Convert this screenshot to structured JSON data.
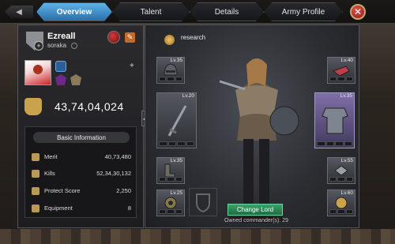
{
  "tabs": [
    {
      "label": "Overview",
      "active": true
    },
    {
      "label": "Talent",
      "active": false
    },
    {
      "label": "Details",
      "active": false
    },
    {
      "label": "Army Profile",
      "active": false
    }
  ],
  "player": {
    "name": "Ezreall",
    "guild": "soraka",
    "power": "43,74,04,024"
  },
  "basic_info": {
    "title": "Basic Information",
    "rows": [
      {
        "label": "Merit",
        "value": "40,73,480",
        "icon": "merit-icon"
      },
      {
        "label": "Kills",
        "value": "52,34,30,132",
        "icon": "swords-icon"
      },
      {
        "label": "Protect Score",
        "value": "2,250",
        "icon": "shield-icon"
      },
      {
        "label": "Equipment",
        "value": "8",
        "icon": "equipment-icon"
      }
    ]
  },
  "research": {
    "label": "research"
  },
  "equipment_slots": [
    {
      "slot": "helmet",
      "level": "Lv.35"
    },
    {
      "slot": "weapon",
      "level": "Lv.20"
    },
    {
      "slot": "boots",
      "level": "Lv.35"
    },
    {
      "slot": "accessory-left",
      "level": "Lv.25"
    },
    {
      "slot": "gloves",
      "level": "Lv.40"
    },
    {
      "slot": "armor",
      "level": "Lv.35"
    },
    {
      "slot": "trinket",
      "level": "Lv.55"
    },
    {
      "slot": "accessory-right",
      "level": "Lv.60"
    }
  ],
  "commander": {
    "change_label": "Change Lord",
    "owned_text": "Owned commander(s): 29"
  },
  "colors": {
    "active_tab": "#3f93d2",
    "change_button": "#2f8a57",
    "close_button": "#c63c3c"
  }
}
